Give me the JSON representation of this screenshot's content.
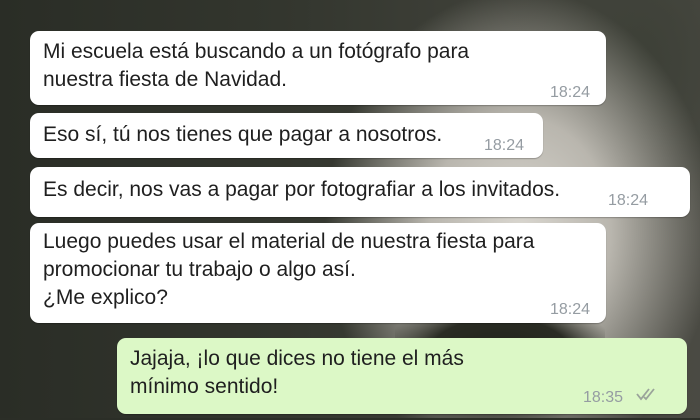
{
  "messages": [
    {
      "direction": "incoming",
      "lines": [
        "Mi escuela está buscando a un fotógrafo para",
        "nuestra fiesta de Navidad."
      ],
      "time": "18:24"
    },
    {
      "direction": "incoming",
      "lines": [
        "Eso sí, tú nos tienes que pagar a nosotros."
      ],
      "time": "18:24"
    },
    {
      "direction": "incoming",
      "lines": [
        "Es decir, nos vas a pagar por fotografiar a los invitados."
      ],
      "time": "18:24"
    },
    {
      "direction": "incoming",
      "lines": [
        "Luego puedes usar el material de nuestra fiesta para",
        "promocionar tu trabajo o algo así.",
        "¿Me explico?"
      ],
      "time": "18:24"
    },
    {
      "direction": "outgoing",
      "lines": [
        "Jajaja, ¡lo que dices no tiene el más",
        "mínimo sentido!"
      ],
      "time": "18:35",
      "status": "read"
    }
  ],
  "colors": {
    "incoming_bubble": "#ffffff",
    "outgoing_bubble": "#dcf8c6",
    "timestamp": "#959ca2"
  },
  "icons": {
    "read_receipt": "double-check-icon"
  }
}
